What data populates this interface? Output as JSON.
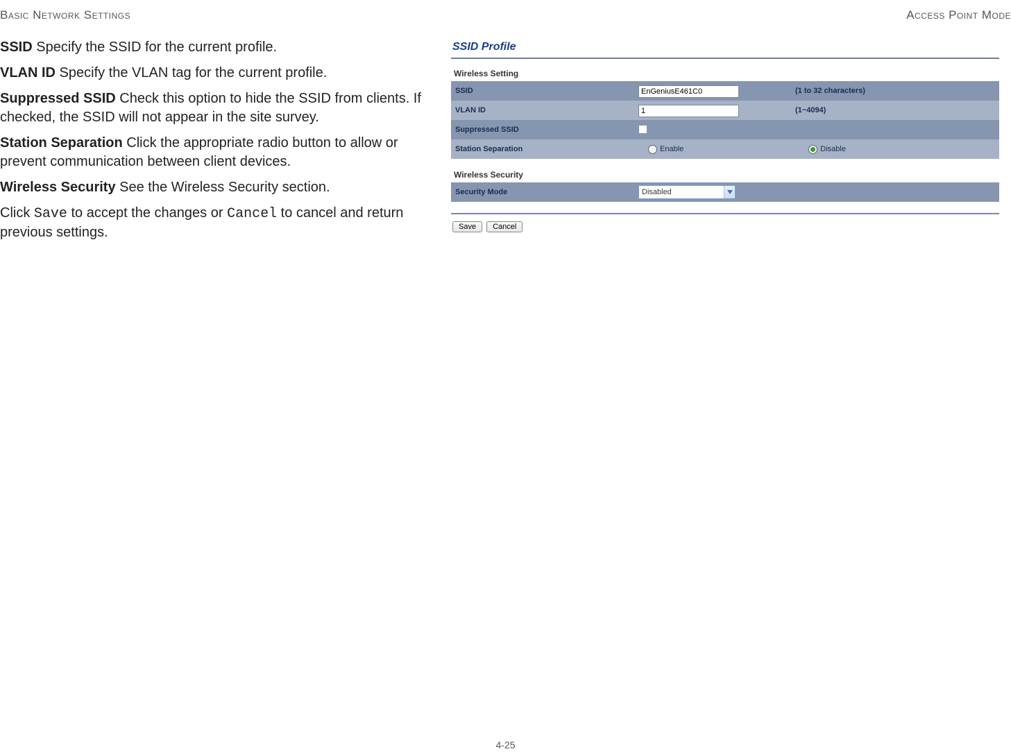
{
  "header": {
    "left": "Basic Network Settings",
    "right": "Access Point Mode"
  },
  "doc": {
    "ssid_term": "SSID",
    "ssid_desc": "  Specify the SSID for the current profile.",
    "vlan_term": "VLAN ID",
    "vlan_desc": "  Specify the VLAN tag for the current profile.",
    "suppressed_term": "Suppressed SSID",
    "suppressed_desc": "  Check this option to hide the SSID from clients. If checked, the SSID will not appear in the site survey.",
    "station_term": "Station Separation",
    "station_desc": "  Click the appropriate radio button to allow or prevent communication between client devices.",
    "wsec_term": "Wireless Security",
    "wsec_desc": "  See the Wireless Security section.",
    "save_pre": "Click ",
    "save_code": "Save",
    "save_mid": " to accept the changes or ",
    "cancel_code": "Cancel",
    "save_post": " to cancel and return previous settings."
  },
  "panel": {
    "title": "SSID Profile",
    "wireless_setting": "Wireless Setting",
    "wireless_security": "Wireless Security",
    "rows": {
      "ssid": {
        "label": "SSID",
        "value": "EnGeniusE461C0",
        "hint": "(1 to 32 characters)"
      },
      "vlan": {
        "label": "VLAN ID",
        "value": "1",
        "hint": "(1~4094)"
      },
      "suppressed": {
        "label": "Suppressed SSID"
      },
      "station": {
        "label": "Station Separation",
        "enable": "Enable",
        "disable": "Disable"
      },
      "security": {
        "label": "Security Mode",
        "value": "Disabled"
      }
    },
    "buttons": {
      "save": "Save",
      "cancel": "Cancel"
    }
  },
  "page_number": "4-25"
}
